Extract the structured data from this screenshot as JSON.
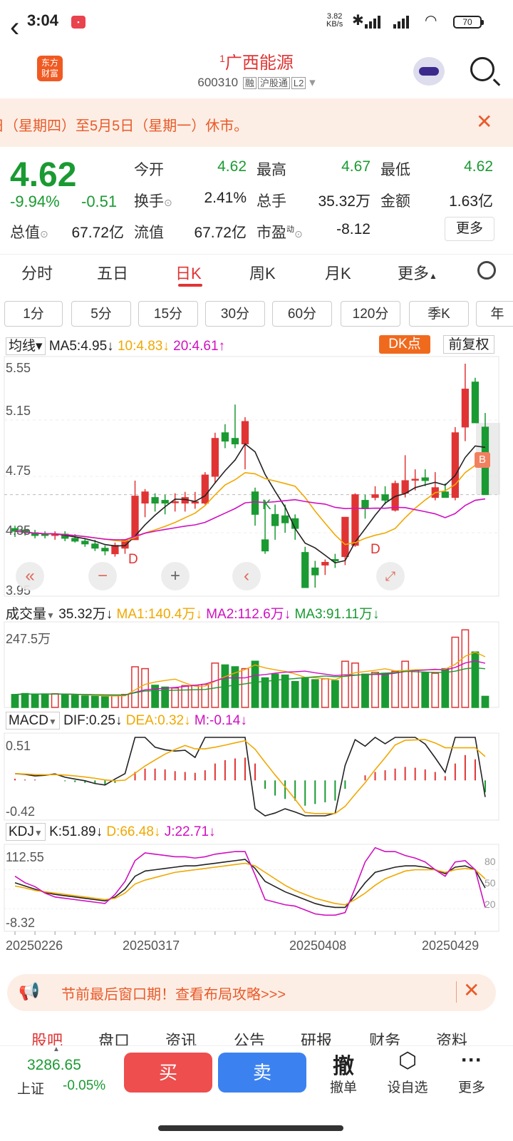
{
  "status_bar": {
    "time": "3:04",
    "net_speed": "3.82",
    "net_unit": "KB/s",
    "battery": "70"
  },
  "header": {
    "logo_line1": "东方",
    "logo_line2": "财富",
    "stock_prefix": "1",
    "stock_name": "广西能源",
    "stock_code": "600310",
    "tags": [
      "融",
      "沪股通",
      "L2"
    ]
  },
  "notice": {
    "text": "日（星期四）至5月5日（星期一）休市。"
  },
  "quote": {
    "price": "4.62",
    "change_pct": "-9.94%",
    "change_amt": "-0.51",
    "fields": [
      {
        "label": "今开",
        "value": "4.62"
      },
      {
        "label": "最高",
        "value": "4.67"
      },
      {
        "label": "最低",
        "value": "4.62"
      },
      {
        "label": "换手",
        "value": "2.41%"
      },
      {
        "label": "总手",
        "value": "35.32万"
      },
      {
        "label": "金额",
        "value": "1.63亿"
      },
      {
        "label": "总值",
        "value": "67.72亿"
      },
      {
        "label": "流值",
        "value": "67.72亿"
      },
      {
        "label": "市盈",
        "label_sup": "动",
        "value": "-8.12"
      }
    ],
    "more": "更多"
  },
  "tabs": [
    "分时",
    "五日",
    "日K",
    "周K",
    "月K",
    "更多"
  ],
  "active_tab": "日K",
  "periods": [
    "1分",
    "5分",
    "15分",
    "30分",
    "60分",
    "120分",
    "季K",
    "年"
  ],
  "kline": {
    "ma_label": "均线",
    "ma5": "MA5:4.95",
    "ma10": "10:4.83",
    "ma20": "20:4.61",
    "dk_label": "DK点",
    "adjust_label": "前复权",
    "y_ticks": [
      "5.55",
      "5.15",
      "4.75",
      "4.35",
      "3.95"
    ],
    "markers": [
      "D",
      "K",
      "D",
      "B"
    ]
  },
  "volume": {
    "label": "成交量",
    "value": "35.32万",
    "ma1": "MA1:140.4万",
    "ma2": "MA2:112.6万",
    "ma3": "MA3:91.11万",
    "y_top": "247.5万"
  },
  "macd": {
    "label": "MACD",
    "dif": "DIF:0.25",
    "dea": "DEA:0.32",
    "m": "M:-0.14",
    "y_top": "0.51",
    "y_bottom": "-0.42"
  },
  "kdj": {
    "label": "KDJ",
    "k": "K:51.89",
    "d": "D:66.48",
    "j": "J:22.71",
    "y_top": "112.55",
    "y_bottom": "-8.32",
    "levels": [
      "80",
      "50",
      "20"
    ]
  },
  "x_dates": [
    "20250226",
    "20250317",
    "20250408",
    "20250429"
  ],
  "promo": {
    "text": "节前最后窗口期！查看布局攻略>>>"
  },
  "bottom_tabs": [
    "股吧",
    "盘口",
    "资讯",
    "公告",
    "研报",
    "财务",
    "资料"
  ],
  "bottom_bar": {
    "index_value": "3286.65",
    "index_name": "上证",
    "index_change": "-0.05%",
    "buy": "买",
    "sell": "卖",
    "actions": [
      {
        "icon": "撤",
        "label": "撤单"
      },
      {
        "icon": "⬡",
        "label": "设自选"
      },
      {
        "icon": "···",
        "label": "更多"
      }
    ]
  },
  "colors": {
    "up": "#e03434",
    "down": "#1a9a32",
    "ma5": "#222222",
    "ma10": "#f0a800",
    "ma20": "#d010c0",
    "accent": "#f06a1e"
  },
  "candles": [
    [
      4.38,
      4.4,
      4.32,
      4.36
    ],
    [
      4.37,
      4.39,
      4.33,
      4.35
    ],
    [
      4.35,
      4.37,
      4.31,
      4.33
    ],
    [
      4.34,
      4.36,
      4.31,
      4.33
    ],
    [
      4.33,
      4.36,
      4.3,
      4.34
    ],
    [
      4.34,
      4.36,
      4.29,
      4.31
    ],
    [
      4.31,
      4.34,
      4.28,
      4.29
    ],
    [
      4.29,
      4.31,
      4.25,
      4.27
    ],
    [
      4.27,
      4.3,
      4.22,
      4.24
    ],
    [
      4.24,
      4.26,
      4.19,
      4.22
    ],
    [
      4.2,
      4.28,
      4.18,
      4.26
    ],
    [
      4.24,
      4.3,
      4.2,
      4.3
    ],
    [
      4.3,
      4.72,
      4.3,
      4.61
    ],
    [
      4.56,
      4.66,
      4.46,
      4.64
    ],
    [
      4.6,
      4.63,
      4.5,
      4.56
    ],
    [
      4.58,
      4.62,
      4.48,
      4.56
    ],
    [
      4.57,
      4.63,
      4.5,
      4.57
    ],
    [
      4.56,
      4.64,
      4.5,
      4.6
    ],
    [
      4.56,
      4.64,
      4.52,
      4.57
    ],
    [
      4.56,
      4.78,
      4.55,
      4.76
    ],
    [
      4.75,
      5.06,
      4.7,
      5.02
    ],
    [
      5.06,
      5.12,
      4.95,
      5.0
    ],
    [
      5.02,
      5.26,
      4.95,
      4.98
    ],
    [
      4.98,
      5.17,
      4.8,
      5.14
    ],
    [
      4.64,
      4.67,
      4.4,
      4.48
    ],
    [
      4.3,
      4.58,
      4.2,
      4.22
    ],
    [
      4.48,
      4.55,
      4.3,
      4.4
    ],
    [
      4.47,
      4.55,
      4.35,
      4.42
    ],
    [
      4.45,
      4.48,
      4.3,
      4.38
    ],
    [
      4.21,
      4.25,
      3.97,
      3.96
    ],
    [
      4.1,
      4.15,
      3.96,
      4.05
    ],
    [
      4.12,
      4.16,
      4.05,
      4.14
    ],
    [
      4.16,
      4.2,
      4.1,
      4.15
    ],
    [
      4.18,
      4.45,
      4.12,
      4.46
    ],
    [
      4.26,
      4.63,
      4.25,
      4.62
    ],
    [
      4.58,
      4.62,
      4.45,
      4.52
    ],
    [
      4.6,
      4.68,
      4.58,
      4.62
    ],
    [
      4.62,
      4.68,
      4.55,
      4.58
    ],
    [
      4.51,
      4.72,
      4.5,
      4.7
    ],
    [
      4.63,
      4.9,
      4.6,
      4.72
    ],
    [
      4.73,
      4.8,
      4.65,
      4.73
    ],
    [
      4.74,
      4.8,
      4.68,
      4.72
    ],
    [
      4.6,
      4.78,
      4.58,
      4.67
    ],
    [
      4.64,
      4.7,
      4.6,
      4.6
    ],
    [
      4.6,
      5.1,
      4.58,
      5.06
    ],
    [
      5.1,
      5.55,
      5.0,
      5.37
    ],
    [
      5.42,
      5.45,
      5.18,
      5.13
    ],
    [
      5.1,
      5.2,
      4.62,
      4.62
    ]
  ],
  "volumes": [
    70,
    75,
    72,
    73,
    74,
    68,
    65,
    62,
    60,
    58,
    66,
    70,
    220,
    210,
    120,
    110,
    105,
    118,
    120,
    125,
    240,
    230,
    220,
    210,
    250,
    160,
    180,
    175,
    140,
    160,
    150,
    155,
    145,
    250,
    240,
    180,
    190,
    185,
    195,
    250,
    200,
    190,
    185,
    210,
    380,
    420,
    300,
    60
  ],
  "macd_values": [
    0.02,
    0.01,
    0.01,
    0.0,
    0.0,
    -0.01,
    -0.02,
    -0.03,
    -0.04,
    -0.05,
    -0.03,
    0.0,
    0.1,
    0.14,
    0.14,
    0.13,
    0.11,
    0.1,
    0.09,
    0.12,
    0.2,
    0.24,
    0.26,
    0.27,
    0.2,
    -0.1,
    -0.18,
    -0.22,
    -0.24,
    -0.3,
    -0.28,
    -0.26,
    -0.24,
    -0.1,
    0.0,
    0.06,
    0.1,
    0.12,
    0.14,
    0.16,
    0.15,
    0.13,
    0.1,
    0.05,
    0.2,
    0.3,
    0.25,
    -0.14
  ],
  "kdj_k": [
    60,
    55,
    50,
    45,
    42,
    40,
    38,
    36,
    34,
    32,
    38,
    50,
    70,
    78,
    80,
    82,
    84,
    86,
    86,
    88,
    90,
    92,
    94,
    96,
    82,
    62,
    54,
    46,
    40,
    34,
    28,
    24,
    22,
    22,
    40,
    60,
    76,
    80,
    84,
    86,
    86,
    84,
    80,
    74,
    84,
    86,
    80,
    52
  ],
  "kdj_d": [
    55,
    52,
    48,
    46,
    44,
    42,
    40,
    38,
    36,
    34,
    36,
    44,
    58,
    64,
    68,
    72,
    76,
    78,
    80,
    82,
    84,
    86,
    88,
    90,
    86,
    76,
    66,
    56,
    48,
    42,
    36,
    32,
    28,
    26,
    34,
    44,
    56,
    66,
    72,
    78,
    80,
    80,
    80,
    76,
    80,
    82,
    80,
    66
  ],
  "kdj_j": [
    70,
    60,
    54,
    44,
    38,
    36,
    34,
    32,
    30,
    28,
    42,
    62,
    94,
    106,
    104,
    102,
    100,
    100,
    98,
    100,
    104,
    106,
    108,
    108,
    72,
    34,
    30,
    26,
    24,
    18,
    12,
    10,
    10,
    14,
    52,
    92,
    114,
    108,
    108,
    102,
    98,
    92,
    80,
    70,
    92,
    94,
    80,
    22
  ]
}
